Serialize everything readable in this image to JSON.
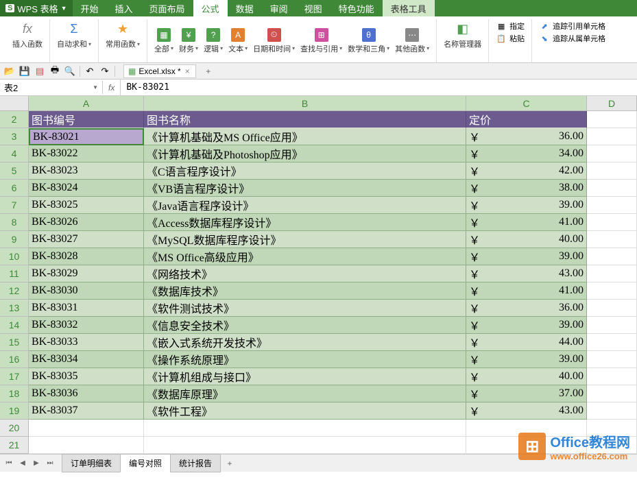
{
  "app": {
    "name": "WPS 表格",
    "logo_letter": "S"
  },
  "menu": {
    "tabs": [
      "开始",
      "插入",
      "页面布局",
      "公式",
      "数据",
      "审阅",
      "视图",
      "特色功能",
      "表格工具"
    ],
    "active_index": 3,
    "tool_index": 8
  },
  "ribbon": {
    "insert_fn": "插入函数",
    "auto_sum": "自动求和",
    "common_fn": "常用函数",
    "all": "全部",
    "finance": "财务",
    "logic": "逻辑",
    "text": "文本",
    "datetime": "日期和时间",
    "lookup": "查找与引用",
    "math": "数学和三角",
    "other_fn": "其他函数",
    "name_mgr": "名称管理器",
    "define": "指定",
    "paste": "粘贴",
    "trace_precedents": "追踪引用单元格",
    "trace_dependents": "追踪从属单元格"
  },
  "file": {
    "name": "Excel.xlsx *"
  },
  "cell_ref": {
    "name": "表2",
    "formula": "BK-83021"
  },
  "columns": [
    "A",
    "B",
    "C",
    "D"
  ],
  "headers": {
    "col_a": "图书编号",
    "col_b": "图书名称",
    "col_c": "定价"
  },
  "rows": [
    {
      "n": 2,
      "type": "header"
    },
    {
      "n": 3,
      "id": "BK-83021",
      "name": "《计算机基础及MS Office应用》",
      "currency": "￥",
      "price": "36.00",
      "active": true
    },
    {
      "n": 4,
      "id": "BK-83022",
      "name": "《计算机基础及Photoshop应用》",
      "currency": "￥",
      "price": "34.00"
    },
    {
      "n": 5,
      "id": "BK-83023",
      "name": "《C语言程序设计》",
      "currency": "￥",
      "price": "42.00"
    },
    {
      "n": 6,
      "id": "BK-83024",
      "name": "《VB语言程序设计》",
      "currency": "￥",
      "price": "38.00"
    },
    {
      "n": 7,
      "id": "BK-83025",
      "name": "《Java语言程序设计》",
      "currency": "￥",
      "price": "39.00"
    },
    {
      "n": 8,
      "id": "BK-83026",
      "name": "《Access数据库程序设计》",
      "currency": "￥",
      "price": "41.00"
    },
    {
      "n": 9,
      "id": "BK-83027",
      "name": "《MySQL数据库程序设计》",
      "currency": "￥",
      "price": "40.00"
    },
    {
      "n": 10,
      "id": "BK-83028",
      "name": "《MS Office高级应用》",
      "currency": "￥",
      "price": "39.00"
    },
    {
      "n": 11,
      "id": "BK-83029",
      "name": "《网络技术》",
      "currency": "￥",
      "price": "43.00"
    },
    {
      "n": 12,
      "id": "BK-83030",
      "name": "《数据库技术》",
      "currency": "￥",
      "price": "41.00"
    },
    {
      "n": 13,
      "id": "BK-83031",
      "name": "《软件测试技术》",
      "currency": "￥",
      "price": "36.00"
    },
    {
      "n": 14,
      "id": "BK-83032",
      "name": "《信息安全技术》",
      "currency": "￥",
      "price": "39.00"
    },
    {
      "n": 15,
      "id": "BK-83033",
      "name": "《嵌入式系统开发技术》",
      "currency": "￥",
      "price": "44.00"
    },
    {
      "n": 16,
      "id": "BK-83034",
      "name": "《操作系统原理》",
      "currency": "￥",
      "price": "39.00"
    },
    {
      "n": 17,
      "id": "BK-83035",
      "name": "《计算机组成与接口》",
      "currency": "￥",
      "price": "40.00"
    },
    {
      "n": 18,
      "id": "BK-83036",
      "name": "《数据库原理》",
      "currency": "￥",
      "price": "37.00"
    },
    {
      "n": 19,
      "id": "BK-83037",
      "name": "《软件工程》",
      "currency": "￥",
      "price": "43.00"
    },
    {
      "n": 20,
      "type": "empty"
    },
    {
      "n": 21,
      "type": "empty"
    }
  ],
  "sheets": {
    "tabs": [
      "订单明细表",
      "编号对照",
      "统计报告"
    ],
    "active_index": 1
  },
  "watermark": {
    "title": "Office教程网",
    "url": "www.office26.com"
  }
}
